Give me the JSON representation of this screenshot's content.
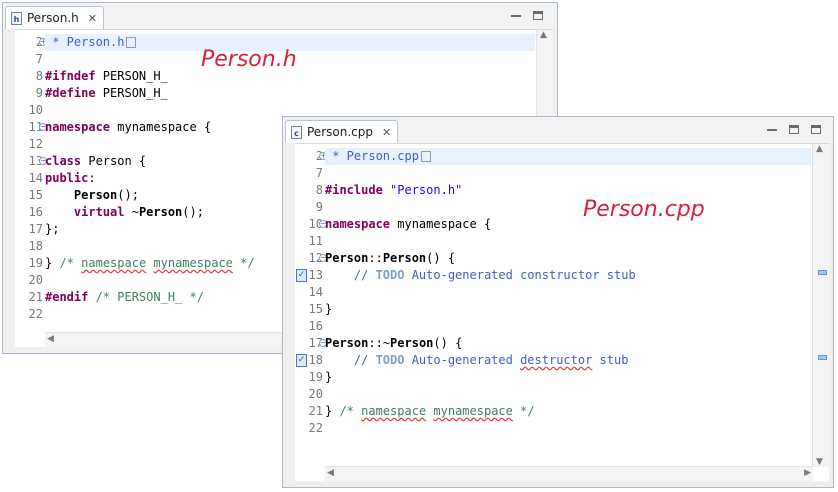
{
  "windows": {
    "header": {
      "tab_label": "Person.h",
      "tab_icon": "h-file-icon",
      "file_badge": "h",
      "annotation": "Person.h",
      "lines": [
        {
          "num": "2",
          "fold": "+",
          "highlight": true,
          "tokens": [
            {
              "t": " * Person.h",
              "c": "doc"
            },
            {
              "t": "",
              "c": "box"
            }
          ]
        },
        {
          "num": "7",
          "tokens": []
        },
        {
          "num": "8",
          "tokens": [
            {
              "t": "#ifndef",
              "c": "kw"
            },
            {
              "t": " PERSON_H_",
              "c": ""
            }
          ]
        },
        {
          "num": "9",
          "tokens": [
            {
              "t": "#define",
              "c": "kw"
            },
            {
              "t": " PERSON_H_",
              "c": ""
            }
          ]
        },
        {
          "num": "10",
          "tokens": []
        },
        {
          "num": "11",
          "fold": "−",
          "tokens": [
            {
              "t": "namespace",
              "c": "kw"
            },
            {
              "t": " mynamespace {",
              "c": ""
            }
          ]
        },
        {
          "num": "12",
          "tokens": []
        },
        {
          "num": "13",
          "fold": "−",
          "tokens": [
            {
              "t": "class",
              "c": "kw"
            },
            {
              "t": " Person {",
              "c": ""
            }
          ]
        },
        {
          "num": "14",
          "tokens": [
            {
              "t": "public",
              "c": "kw"
            },
            {
              "t": ":",
              "c": ""
            }
          ]
        },
        {
          "num": "15",
          "tokens": [
            {
              "t": "    ",
              "c": ""
            },
            {
              "t": "Person",
              "c": "fn"
            },
            {
              "t": "();",
              "c": ""
            }
          ]
        },
        {
          "num": "16",
          "tokens": [
            {
              "t": "    ",
              "c": ""
            },
            {
              "t": "virtual",
              "c": "kw"
            },
            {
              "t": " ~",
              "c": ""
            },
            {
              "t": "Person",
              "c": "fn"
            },
            {
              "t": "();",
              "c": ""
            }
          ]
        },
        {
          "num": "17",
          "tokens": [
            {
              "t": "};",
              "c": ""
            }
          ]
        },
        {
          "num": "18",
          "tokens": []
        },
        {
          "num": "19",
          "tokens": [
            {
              "t": "} ",
              "c": ""
            },
            {
              "t": "/* ",
              "c": "cm"
            },
            {
              "t": "namespace",
              "c": "cm spell"
            },
            {
              "t": " ",
              "c": "cm"
            },
            {
              "t": "mynamespace",
              "c": "cm spell"
            },
            {
              "t": " */",
              "c": "cm"
            }
          ]
        },
        {
          "num": "20",
          "tokens": []
        },
        {
          "num": "21",
          "tokens": [
            {
              "t": "#endif",
              "c": "kw"
            },
            {
              "t": " /* PERSON_H_ */",
              "c": "cm"
            }
          ]
        },
        {
          "num": "22",
          "tokens": []
        }
      ]
    },
    "source": {
      "tab_label": "Person.cpp",
      "tab_icon": "c-file-icon",
      "file_badge": "c",
      "annotation": "Person.cpp",
      "lines": [
        {
          "num": "2",
          "fold": "+",
          "highlight": true,
          "tokens": [
            {
              "t": " * Person.cpp",
              "c": "doc"
            },
            {
              "t": "",
              "c": "box"
            }
          ]
        },
        {
          "num": "7",
          "tokens": []
        },
        {
          "num": "8",
          "tokens": [
            {
              "t": "#include",
              "c": "kw"
            },
            {
              "t": " ",
              "c": ""
            },
            {
              "t": "\"Person.h\"",
              "c": "str"
            }
          ]
        },
        {
          "num": "9",
          "tokens": []
        },
        {
          "num": "10",
          "fold": "−",
          "tokens": [
            {
              "t": "namespace",
              "c": "kw"
            },
            {
              "t": " mynamespace {",
              "c": ""
            }
          ]
        },
        {
          "num": "11",
          "tokens": []
        },
        {
          "num": "12",
          "fold": "−",
          "tokens": [
            {
              "t": "Person",
              "c": "fn"
            },
            {
              "t": "::",
              "c": ""
            },
            {
              "t": "Person",
              "c": "fn"
            },
            {
              "t": "() {",
              "c": ""
            }
          ]
        },
        {
          "num": "13",
          "task": true,
          "tokens": [
            {
              "t": "    // ",
              "c": "doc"
            },
            {
              "t": "TODO",
              "c": "todo"
            },
            {
              "t": " Auto-generated constructor stub",
              "c": "doc"
            }
          ]
        },
        {
          "num": "14",
          "tokens": []
        },
        {
          "num": "15",
          "tokens": [
            {
              "t": "}",
              "c": ""
            }
          ]
        },
        {
          "num": "16",
          "tokens": []
        },
        {
          "num": "17",
          "fold": "−",
          "tokens": [
            {
              "t": "Person",
              "c": "fn"
            },
            {
              "t": "::~",
              "c": ""
            },
            {
              "t": "Person",
              "c": "fn"
            },
            {
              "t": "() {",
              "c": ""
            }
          ]
        },
        {
          "num": "18",
          "task": true,
          "tokens": [
            {
              "t": "    // ",
              "c": "doc"
            },
            {
              "t": "TODO",
              "c": "todo"
            },
            {
              "t": " Auto-generated ",
              "c": "doc"
            },
            {
              "t": "destructor",
              "c": "doc spell"
            },
            {
              "t": " stub",
              "c": "doc"
            }
          ]
        },
        {
          "num": "19",
          "tokens": [
            {
              "t": "}",
              "c": ""
            }
          ]
        },
        {
          "num": "20",
          "tokens": []
        },
        {
          "num": "21",
          "tokens": [
            {
              "t": "} ",
              "c": ""
            },
            {
              "t": "/* ",
              "c": "cm"
            },
            {
              "t": "namespace",
              "c": "cm spell"
            },
            {
              "t": " ",
              "c": "cm"
            },
            {
              "t": "mynamespace",
              "c": "cm spell"
            },
            {
              "t": " */",
              "c": "cm"
            }
          ]
        },
        {
          "num": "22",
          "tokens": []
        }
      ]
    }
  },
  "colors": {
    "keyword": "#7f0055",
    "comment": "#3f7f5f",
    "doc_comment": "#3f5fbf",
    "string": "#2a00ff",
    "annotation_text": "#d4213d",
    "highlight_line": "#e8f2fe"
  }
}
